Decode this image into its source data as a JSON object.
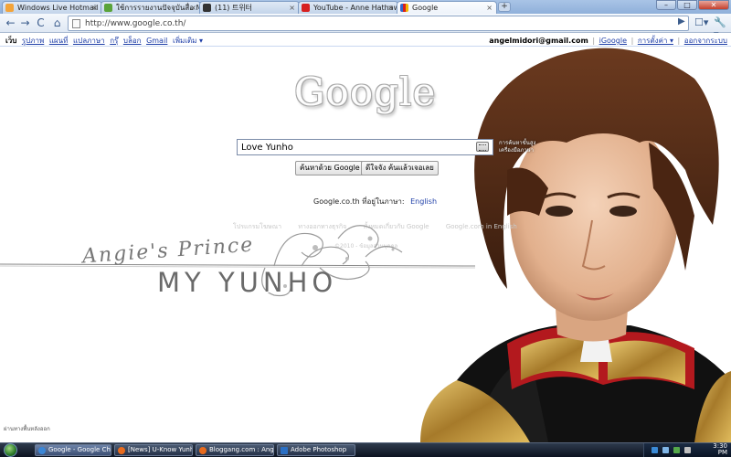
{
  "browser": {
    "tabs": [
      {
        "label": "Windows Live Hotmail",
        "icon": "hotmail-icon",
        "color": "#f3a43a"
      },
      {
        "label": "ใช้การรายงานปัจจุบันสื่อ Mu...",
        "icon": "clover-icon",
        "color": "#5aa33a"
      },
      {
        "label": "(11) 트위터",
        "icon": "twitter-icon",
        "color": "#333333"
      },
      {
        "label": "YouTube - Anne Hathaway...",
        "icon": "youtube-icon",
        "color": "#d62020"
      },
      {
        "label": "Google",
        "icon": "google-icon",
        "color": "#3366cc",
        "active": true
      }
    ],
    "tab_close": "×",
    "new_tab": "+",
    "window_controls": {
      "minimize": "–",
      "maximize": "□",
      "close": "✕"
    },
    "url": "http://www.google.co.th/",
    "buttons": {
      "back": "←",
      "forward": "→",
      "reload": "C",
      "home": "⌂",
      "go": "▶",
      "page_menu": "☐▾",
      "tools": "🔧▾"
    }
  },
  "google_bar": {
    "items": [
      {
        "label": "เว็บ",
        "bold": true
      },
      {
        "label": "รูปภาพ"
      },
      {
        "label": "แผนที่"
      },
      {
        "label": "แปลภาษา"
      },
      {
        "label": "กรุ๊"
      },
      {
        "label": "บล็อก"
      },
      {
        "label": "Gmail"
      },
      {
        "label": "เพิ่มเติม ▾",
        "more": true
      }
    ],
    "user": {
      "email": "angelmidori@gmail.com",
      "sep": "|",
      "igoogle": "iGoogle",
      "settings": "การตั้งค่า ▾",
      "signout": "ออกจากระบบ"
    }
  },
  "search": {
    "logo_text": "Google",
    "query": "Love Yunho",
    "advanced_link": "การค้นหาขั้นสูง เครื่องมือภาษา",
    "button_search": "ค้นหาด้วย Google",
    "button_lucky": "ดีใจจัง ค้นแล้วเจอเลย",
    "lang_prefix": "Google.co.th ที่อยู่ในภาษา:",
    "lang_english": "English",
    "footer_links": [
      "โปรแกรมโฆษณา",
      "ทางออกทางธุรกิจ",
      "ทั้งหมดเกี่ยวกับ Google",
      "Google.com in English"
    ],
    "copyright": "©2010 - ข้อมูลส่วนบุคคล"
  },
  "artwork": {
    "script_text": "Angie's Prince",
    "title_text": "MY YUNHO",
    "page_footer": "ผ่านทางพื้นหลังออก"
  },
  "taskbar": {
    "tasks": [
      {
        "label": "Google - Google Chrome",
        "color": "#3a86d6",
        "active": true
      },
      {
        "label": "[News] U-Know Yunho...",
        "color": "#e86b1e"
      },
      {
        "label": "Bloggang.com : Angel...",
        "color": "#e86b1e"
      },
      {
        "label": "Adobe Photoshop",
        "color": "#2a6fc4"
      }
    ],
    "clock_time": "3:30",
    "clock_period": "PM"
  }
}
